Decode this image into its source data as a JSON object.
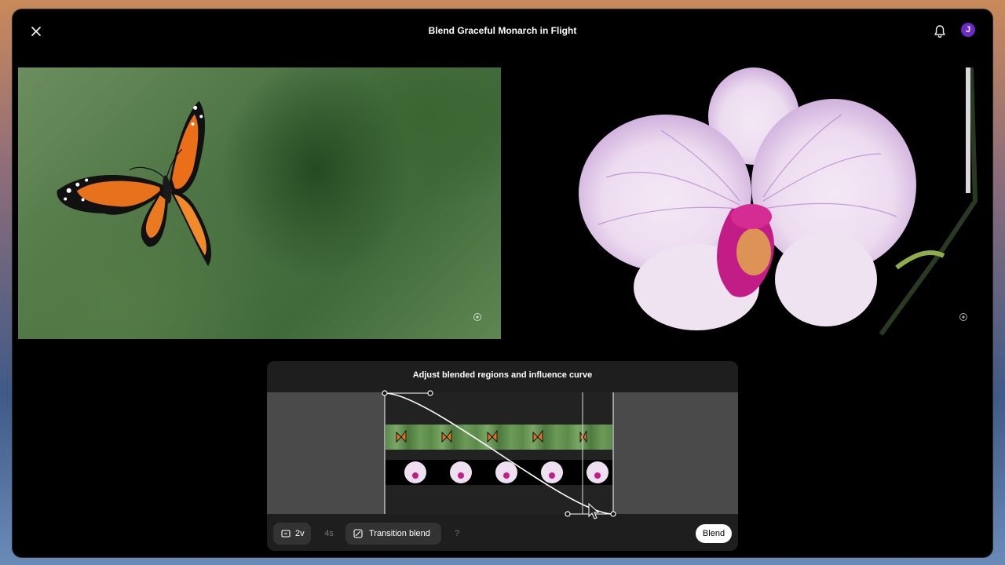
{
  "header": {
    "title": "Blend Graceful Monarch in Flight",
    "avatar_initial": "J",
    "avatar_color": "#6b2bc4"
  },
  "icons": {
    "close": "close-icon",
    "notifications": "bell-icon",
    "watermark": "gear-icon"
  },
  "images": {
    "left": "monarch butterfly in flight over green blurred foliage",
    "right": "white and purple orchid flower on black background"
  },
  "panel": {
    "title": "Adjust blended regions and influence curve"
  },
  "toolbar": {
    "count_label": "2v",
    "duration_label": "4s",
    "mode_label": "Transition blend",
    "help_label": "?",
    "blend_label": "Blend"
  }
}
